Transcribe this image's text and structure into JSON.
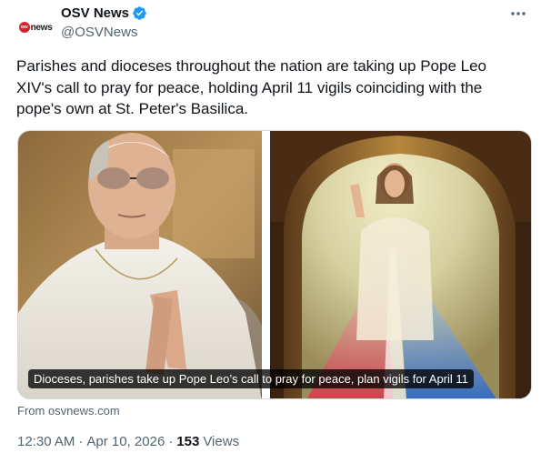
{
  "author": {
    "display_name": "OSV News",
    "handle": "@OSVNews",
    "verified": true,
    "logo_dot": "osv",
    "logo_word": "news"
  },
  "tweet": {
    "text": "Parishes and dioceses throughout the nation are taking up Pope Leo XIV's call to pray for peace, holding April 11 vigils coinciding with the pope's own at St. Peter's Basilica."
  },
  "card": {
    "caption": "Dioceses, parishes take up Pope Leo’s call to pray for peace, plan vigils for April 11",
    "source": "From osvnews.com"
  },
  "meta": {
    "time": "12:30 AM",
    "separator": "·",
    "date": "Apr 10, 2026",
    "views_count": "153",
    "views_label": "Views"
  },
  "colors": {
    "verified_badge": "#1d9bf0",
    "secondary_text": "#536471",
    "logo_red": "#d2232a"
  },
  "icons": {
    "more": "more-icon",
    "verified": "verified-badge-icon"
  }
}
